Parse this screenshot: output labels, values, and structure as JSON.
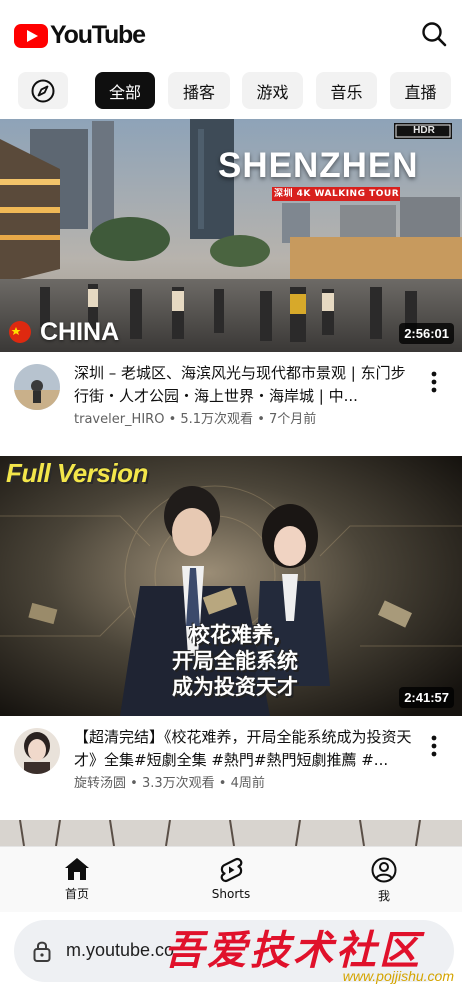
{
  "app": {
    "logo_text": "YouTube"
  },
  "chips": [
    {
      "label": "全部",
      "active": true
    },
    {
      "label": "播客"
    },
    {
      "label": "游戏"
    },
    {
      "label": "音乐"
    },
    {
      "label": "直播"
    }
  ],
  "videos": [
    {
      "thumb_title": "SHENZHEN",
      "thumb_subtitle": "深圳 4K WALKING TOUR",
      "thumb_badge": "HDR",
      "thumb_country": "CHINA",
      "duration": "2:56:01",
      "title": "深圳 – 老城区、海滨风光与现代都市景观 | 东门步行街・人才公园・海上世界・海岸城 | 中...",
      "channel": "traveler_HIRO",
      "views": "5.1万次观看",
      "age": "7个月前"
    },
    {
      "thumb_title": "Full Version",
      "thumb_caption": [
        "校花难养,",
        "开局全能系统",
        "成为投资天才"
      ],
      "duration": "2:41:57",
      "title": "【超清完结】《校花难养，开局全能系统成为投资天才》全集#短劇全集 #熱門#熱門短劇推薦 #...",
      "channel": "旋转汤圆",
      "views": "3.3万次观看",
      "age": "4周前"
    }
  ],
  "bottom_nav": {
    "home": "首页",
    "shorts": "Shorts",
    "you": "我"
  },
  "browser": {
    "url": "m.youtube.co"
  },
  "watermark": {
    "text": "吾爱技术社区",
    "url": "www.pojjishu.com"
  },
  "colors": {
    "brand_red": "#ff0000",
    "chip_bg": "#f2f2f2",
    "chip_active_bg": "#0f0f0f"
  }
}
